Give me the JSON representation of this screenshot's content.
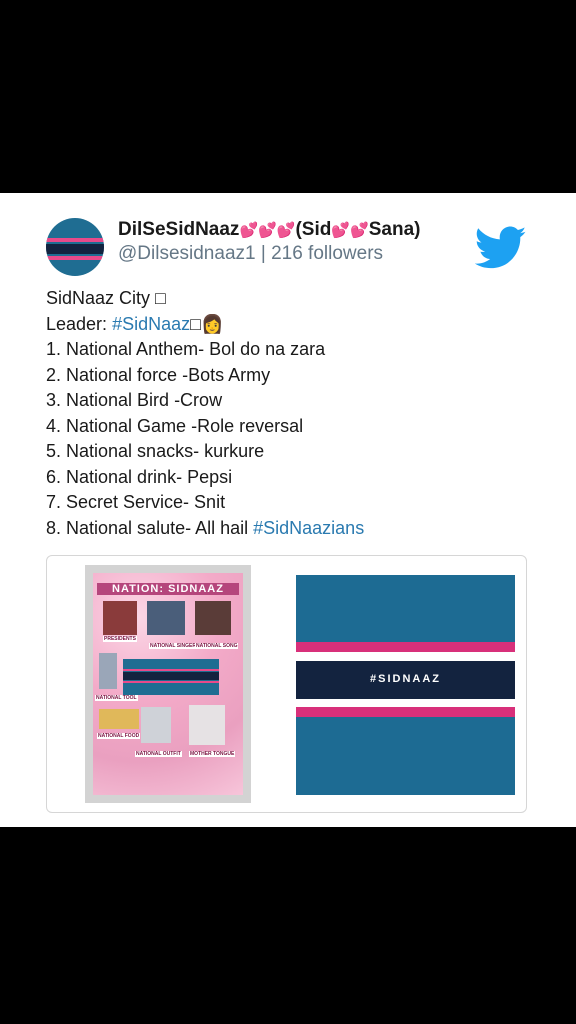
{
  "tweet_header": {
    "name_parts": [
      "DilSeSidNaaz",
      "💕💕💕",
      "(Sid",
      "💕💕",
      "Sana)"
    ],
    "handle": "@Dilsesidnaaz1",
    "separator": "|",
    "followers": "216 followers",
    "twitter_icon": "twitter-bird-icon"
  },
  "tweet": {
    "line_city": "SidNaaz City ",
    "line_city_glyph": "□",
    "leader_label": "Leader: ",
    "leader_tag": "#SidNaaz",
    "leader_glyph": "□",
    "leader_emoji": "👩",
    "items": [
      "1. National Anthem- Bol do na zara",
      "2. National force -Bots Army",
      "3. National Bird -Crow",
      "4. National Game -Role reversal",
      "5. National snacks- kurkure",
      "6. National drink- Pepsi",
      "7. Secret Service- Snit"
    ],
    "last_prefix": "8. National salute- All hail ",
    "last_tag": "#SidNaazians"
  },
  "media": {
    "poster": {
      "title": "NATION: SIDNAAZ",
      "labels": [
        "PRESIDENTS",
        "NATIONAL SINGER",
        "NATIONAL SONG",
        "NATIONAL TOOL",
        "NATIONAL FOOD",
        "NATIONAL OUTFIT",
        "MOTHER TONGUE"
      ]
    },
    "flag_text": "#SIDNAAZ"
  },
  "colors": {
    "hashtag": "#2a7ab0",
    "twitter_blue": "#1da1f2",
    "flag_blue": "#1d6b93",
    "flag_pink": "#d8307a",
    "flag_navy": "#13233f"
  }
}
